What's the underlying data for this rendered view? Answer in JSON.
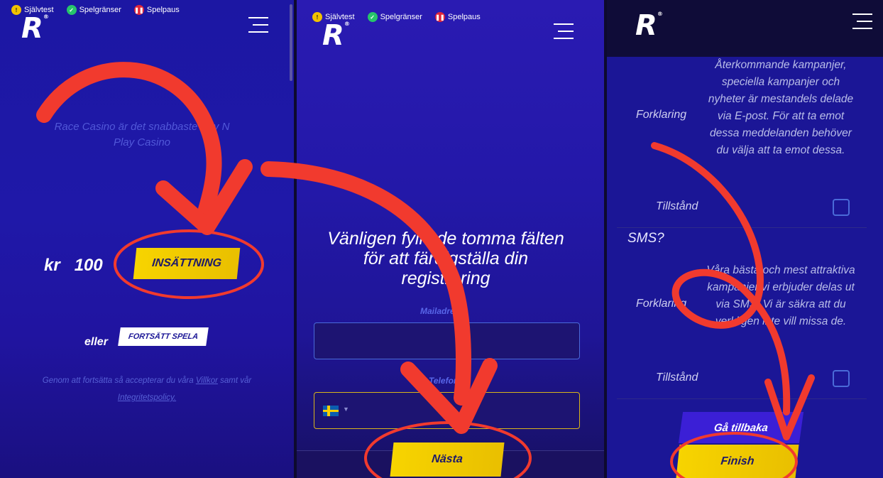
{
  "top_links": {
    "self_test": "Självtest",
    "limits": "Spelgränser",
    "pause": "Spelpaus"
  },
  "logo": {
    "letter": "R",
    "trademark": "®"
  },
  "panel1": {
    "tagline": "Race Casino är det snabbaste Pay N Play Casino",
    "currency": "kr",
    "amount": "100",
    "deposit_label": "INSÄTTNING",
    "or_label": "eller",
    "continue_label": "FORTSÄTT SPELA",
    "terms_prefix": "Genom att fortsätta så accepterar du våra",
    "terms_link": "Villkor",
    "terms_mid": "samt vår",
    "privacy_link": "Integritetspolicy."
  },
  "panel2": {
    "heading": "Vänligen fyll i de tomma fälten för att färdigställa din registrering",
    "email_label": "Mailadress",
    "phone_label": "Telefon",
    "next_label": "Nästa"
  },
  "panel3": {
    "email_desc_label": "Forklaring",
    "email_desc": "Återkommande kampanjer, speciella kampanjer och nyheter är mestandels delade via E-post. För att ta emot dessa meddelanden behöver du välja att ta emot dessa.",
    "permission_label_1": "Tillstånd",
    "sms_heading": "SMS?",
    "sms_desc_label": "Forklaring",
    "sms_desc": "Våra bästa och mest attraktiva kampanjer vi erbjuder delas ut via SMS. Vi är säkra att du verkligen inte vill missa de.",
    "permission_label_2": "Tillstånd",
    "back_label": "Gå tillbaka",
    "finish_label": "Finish"
  },
  "colors": {
    "accent_yellow": "#f7d400",
    "annotation_red": "#f13a2e",
    "background_blue": "#1f18a8"
  }
}
